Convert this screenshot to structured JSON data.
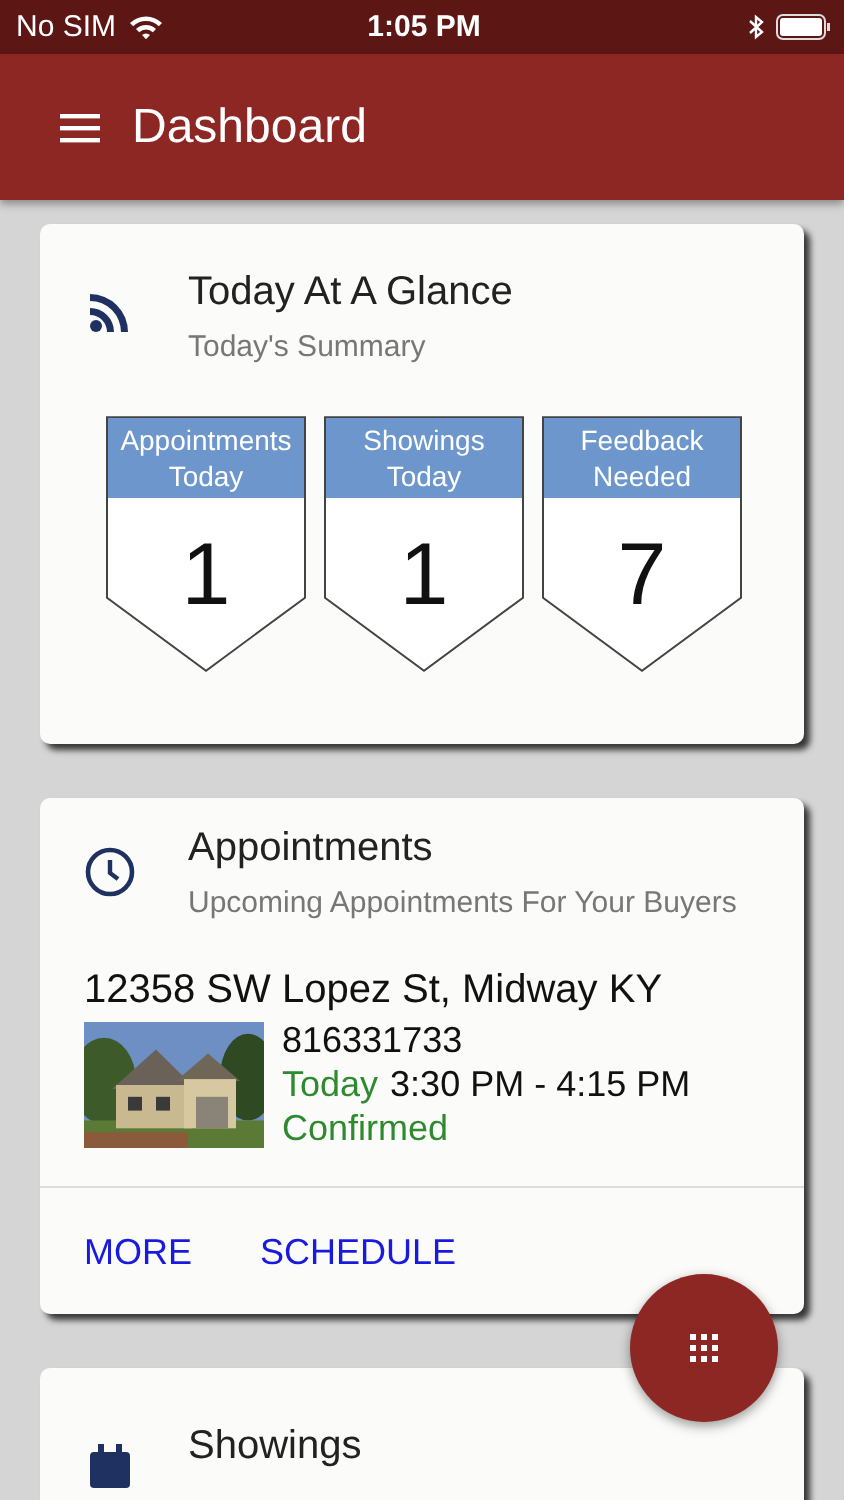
{
  "status_bar": {
    "carrier": "No SIM",
    "time": "1:05 PM"
  },
  "header": {
    "title": "Dashboard"
  },
  "glance": {
    "title": "Today At A Glance",
    "subtitle": "Today's Summary",
    "badges": [
      {
        "label": "Appointments Today",
        "value": "1"
      },
      {
        "label": "Showings Today",
        "value": "1"
      },
      {
        "label": "Feedback Needed",
        "value": "7"
      }
    ]
  },
  "appointments": {
    "title": "Appointments",
    "subtitle": "Upcoming Appointments For Your Buyers",
    "item": {
      "address": "12358 SW Lopez St, Midway KY",
      "id": "816331733",
      "day": "Today",
      "time": "3:30 PM - 4:15 PM",
      "status": "Confirmed"
    },
    "actions": [
      "MORE",
      "SCHEDULE"
    ]
  },
  "showings": {
    "title": "Showings"
  }
}
